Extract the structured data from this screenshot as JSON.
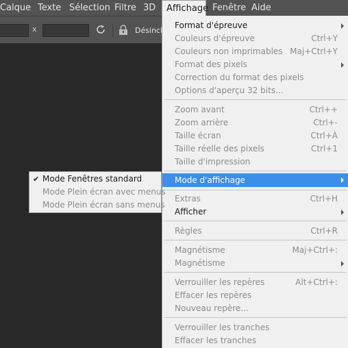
{
  "menubar": {
    "items": [
      "Calque",
      "Texte",
      "Sélection",
      "Filtre",
      "3D",
      "Affichage",
      "Fenêtre",
      "Aide"
    ],
    "active": "Affichage"
  },
  "optionsbar": {
    "separator": "x",
    "button_label": "Désinclin"
  },
  "menu": {
    "items": [
      {
        "label": "Format d'épreuve",
        "shortcut": "",
        "submenu": true,
        "enabled": true
      },
      {
        "label": "Couleurs d'épreuve",
        "shortcut": "Ctrl+Y",
        "submenu": false,
        "enabled": false
      },
      {
        "label": "Couleurs non imprimables",
        "shortcut": "Maj+Ctrl+Y",
        "submenu": false,
        "enabled": false
      },
      {
        "label": "Format des pixels",
        "shortcut": "",
        "submenu": true,
        "enabled": false
      },
      {
        "label": "Correction du format des pixels",
        "shortcut": "",
        "submenu": false,
        "enabled": false
      },
      {
        "label": "Options d'aperçu 32 bits...",
        "shortcut": "",
        "submenu": false,
        "enabled": false
      },
      {
        "label": "Zoom avant",
        "shortcut": "Ctrl++",
        "submenu": false,
        "enabled": false
      },
      {
        "label": "Zoom arrière",
        "shortcut": "Ctrl+-",
        "submenu": false,
        "enabled": false
      },
      {
        "label": "Taille écran",
        "shortcut": "Ctrl+À",
        "submenu": false,
        "enabled": false
      },
      {
        "label": "Taille réelle des pixels",
        "shortcut": "Ctrl+1",
        "submenu": false,
        "enabled": false
      },
      {
        "label": "Taille d'impression",
        "shortcut": "",
        "submenu": false,
        "enabled": false
      },
      {
        "label": "Mode d'affichage",
        "shortcut": "",
        "submenu": true,
        "enabled": true,
        "highlighted": true
      },
      {
        "label": "Extras",
        "shortcut": "Ctrl+H",
        "submenu": false,
        "enabled": false
      },
      {
        "label": "Afficher",
        "shortcut": "",
        "submenu": true,
        "enabled": true
      },
      {
        "label": "Règles",
        "shortcut": "Ctrl+R",
        "submenu": false,
        "enabled": false
      },
      {
        "label": "Magnétisme",
        "shortcut": "Maj+Ctrl+:",
        "submenu": false,
        "enabled": false
      },
      {
        "label": "Magnétisme",
        "shortcut": "",
        "submenu": true,
        "enabled": false
      },
      {
        "label": "Verrouiller les repères",
        "shortcut": "Alt+Ctrl+:",
        "submenu": false,
        "enabled": false
      },
      {
        "label": "Effacer les repères",
        "shortcut": "",
        "submenu": false,
        "enabled": false
      },
      {
        "label": "Nouveau repère...",
        "shortcut": "",
        "submenu": false,
        "enabled": false
      },
      {
        "label": "Verrouiller les tranches",
        "shortcut": "",
        "submenu": false,
        "enabled": false
      },
      {
        "label": "Effacer les tranches",
        "shortcut": "",
        "submenu": false,
        "enabled": false
      }
    ]
  },
  "submenu": {
    "items": [
      {
        "label": "Mode Fenêtres standard",
        "checked": true,
        "enabled": true
      },
      {
        "label": "Mode Plein écran avec menus",
        "checked": false,
        "enabled": false
      },
      {
        "label": "Mode Plein écran sans menus",
        "checked": false,
        "enabled": false
      }
    ]
  },
  "icons": {
    "rotate": "rotate-icon",
    "lock": "lock-icon",
    "check": "checkmark-icon",
    "arrow": "submenu-arrow-icon"
  },
  "colors": {
    "highlight": "#3d8ee8",
    "menu_bg": "#f0f0f0",
    "disabled_text": "#8c8c8c",
    "enabled_text": "#1a1a1a",
    "workspace": "#282828",
    "chrome": "#535353"
  }
}
